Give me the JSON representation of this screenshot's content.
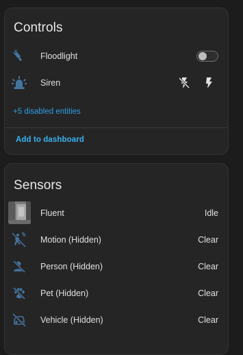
{
  "controls": {
    "title": "Controls",
    "entities": [
      {
        "label": "Floodlight",
        "icon": "floodlight-icon",
        "control": "toggle-off"
      },
      {
        "label": "Siren",
        "icon": "alarm-light-icon",
        "control": "flash-buttons"
      }
    ],
    "disabled_link": "+5 disabled entities",
    "add_button": "Add to dashboard"
  },
  "sensors": {
    "title": "Sensors",
    "entities": [
      {
        "label": "Fluent",
        "icon": "camera-thumbnail",
        "state": "Idle"
      },
      {
        "label": "Motion (Hidden)",
        "icon": "motion-sensor-off-icon",
        "state": "Clear"
      },
      {
        "label": "Person (Hidden)",
        "icon": "account-off-icon",
        "state": "Clear"
      },
      {
        "label": "Pet (Hidden)",
        "icon": "paw-off-icon",
        "state": "Clear"
      },
      {
        "label": "Vehicle (Hidden)",
        "icon": "car-off-icon",
        "state": "Clear"
      }
    ]
  },
  "colors": {
    "background": "#1c1c1c",
    "card": "#252525",
    "icon": "#44739e",
    "link": "#38b2f0"
  }
}
